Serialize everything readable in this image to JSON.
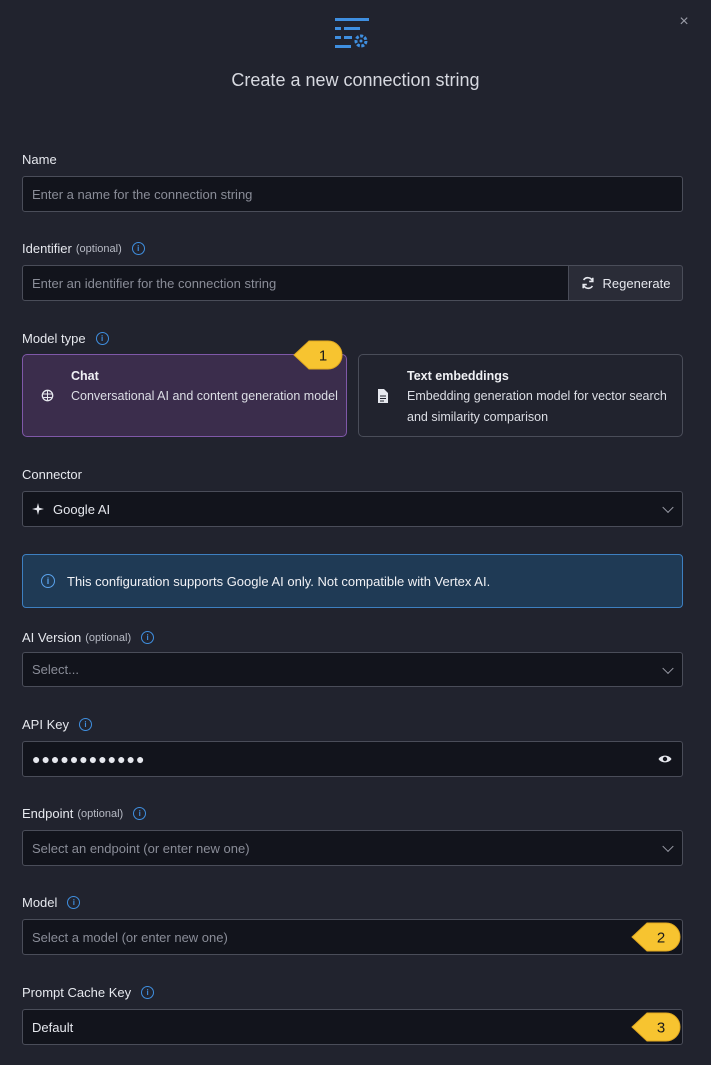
{
  "header": {
    "icon": "settings-list-icon",
    "title": "Create a new connection string",
    "close_icon": "close-icon",
    "close_label": "×"
  },
  "name": {
    "label": "Name",
    "placeholder": "Enter a name for the connection string"
  },
  "identifier": {
    "label": "Identifier",
    "optional": "(optional)",
    "placeholder": "Enter an identifier for the connection string",
    "regenerate_label": "Regenerate"
  },
  "model_type": {
    "label": "Model type",
    "options": [
      {
        "title": "Chat",
        "description": "Conversational AI and content generation model",
        "icon": "brain-icon",
        "selected": true
      },
      {
        "title": "Text embeddings",
        "description": "Embedding generation model for vector search and similarity comparison",
        "icon": "document-icon",
        "selected": false
      }
    ]
  },
  "connector": {
    "label": "Connector",
    "value": "Google AI",
    "icon": "sparkle-icon"
  },
  "alert": {
    "text": "This configuration supports Google AI only. Not compatible with Vertex AI."
  },
  "ai_version": {
    "label": "AI Version",
    "optional": "(optional)",
    "placeholder": "Select..."
  },
  "api_key": {
    "label": "API Key",
    "masked_value": "●●●●●●●●●●●●"
  },
  "endpoint": {
    "label": "Endpoint",
    "optional": "(optional)",
    "placeholder": "Select an endpoint (or enter new one)"
  },
  "model": {
    "label": "Model",
    "placeholder": "Select a model (or enter new one)"
  },
  "prompt_cache_key": {
    "label": "Prompt Cache Key",
    "value": "Default"
  },
  "callouts": [
    "1",
    "2",
    "3"
  ],
  "colors": {
    "accent": "#3f8fe0",
    "callout": "#f7c430",
    "selected_card": "#3b2d4c"
  }
}
